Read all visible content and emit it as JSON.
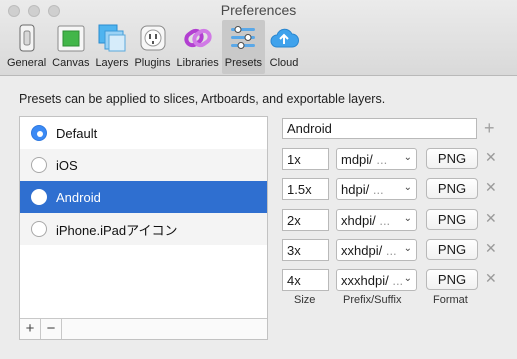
{
  "window": {
    "title": "Preferences"
  },
  "toolbar": {
    "items": [
      {
        "label": "General",
        "icon": "general-icon"
      },
      {
        "label": "Canvas",
        "icon": "canvas-icon"
      },
      {
        "label": "Layers",
        "icon": "layers-icon"
      },
      {
        "label": "Plugins",
        "icon": "plugins-icon"
      },
      {
        "label": "Libraries",
        "icon": "libraries-icon"
      },
      {
        "label": "Presets",
        "icon": "presets-icon",
        "selected": true
      },
      {
        "label": "Cloud",
        "icon": "cloud-icon"
      }
    ]
  },
  "description": "Presets can be applied to slices, Artboards, and exportable layers.",
  "presets": {
    "items": [
      {
        "label": "Default",
        "checked": true
      },
      {
        "label": "iOS"
      },
      {
        "label": "Android",
        "selected": true
      },
      {
        "label": "iPhone.iPadアイコン"
      }
    ],
    "footer": {
      "add": "+",
      "remove": "−"
    }
  },
  "editor": {
    "name": "Android",
    "rows": [
      {
        "scale": "1x",
        "prefix": "mdpi/",
        "prefix_hint": "...",
        "format": "PNG"
      },
      {
        "scale": "1.5x",
        "prefix": "hdpi/",
        "prefix_hint": "...",
        "format": "PNG"
      },
      {
        "scale": "2x",
        "prefix": "xhdpi/",
        "prefix_hint": "...",
        "format": "PNG"
      },
      {
        "scale": "3x",
        "prefix": "xxhdpi/",
        "prefix_hint": "...",
        "format": "PNG"
      },
      {
        "scale": "4x",
        "prefix": "xxxhdpi/",
        "prefix_hint": "...",
        "format": "PNG"
      }
    ],
    "columns": {
      "size": "Size",
      "prefix": "Prefix/Suffix",
      "format": "Format"
    }
  },
  "colors": {
    "selection": "#2f6fd0",
    "radio_accent": "#3b8af5"
  }
}
